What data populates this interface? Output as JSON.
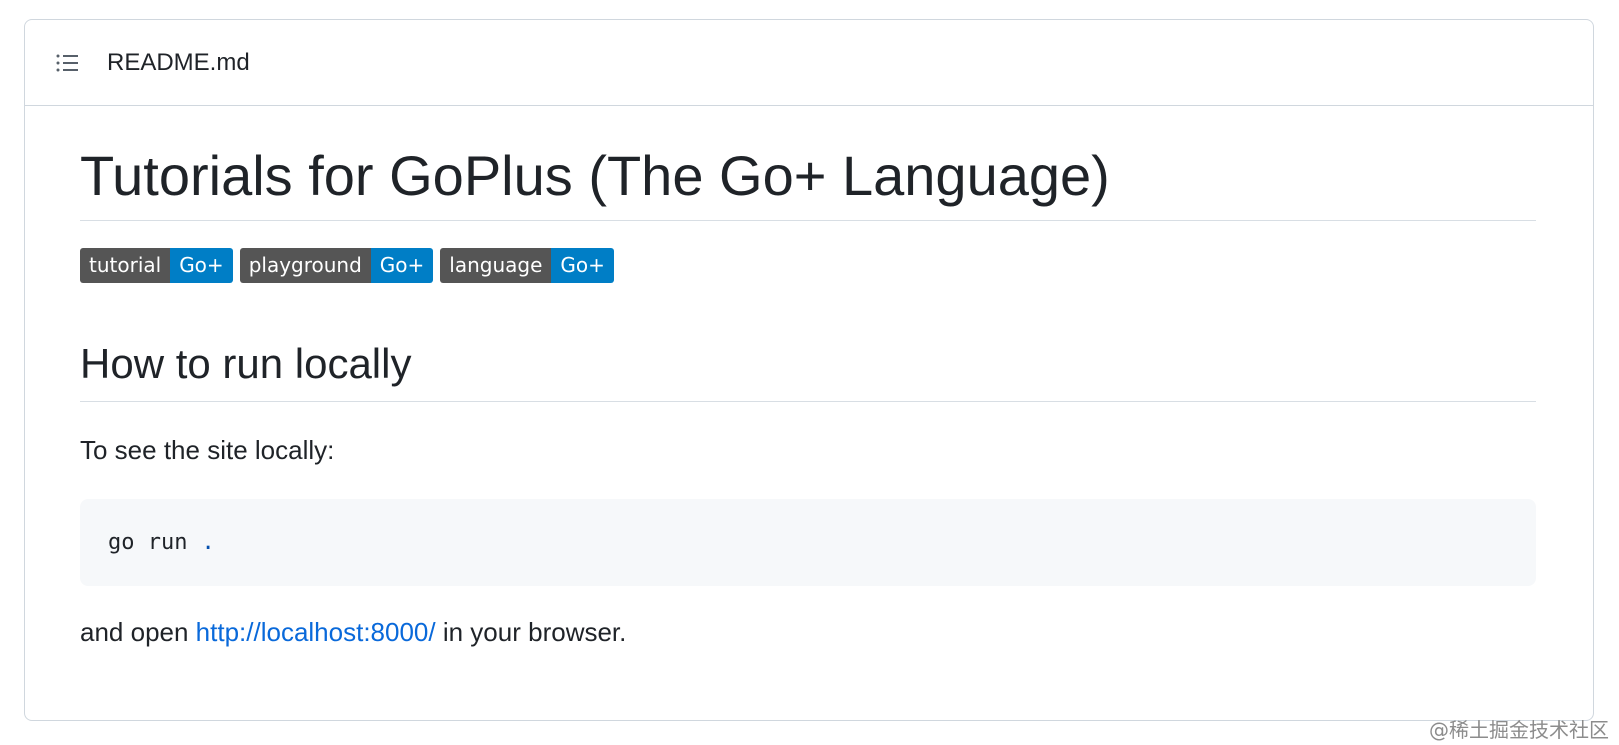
{
  "header": {
    "icon": "list-icon",
    "title": "README.md"
  },
  "readme": {
    "title": "Tutorials for GoPlus (The Go+ Language)",
    "badges": [
      {
        "left": "tutorial",
        "right": "Go+"
      },
      {
        "left": "playground",
        "right": "Go+"
      },
      {
        "left": "language",
        "right": "Go+"
      }
    ],
    "section_heading": "How to run locally",
    "intro_text": "To see the site locally:",
    "code": {
      "command": "go run",
      "arg": "."
    },
    "outro": {
      "before": "and open ",
      "link": "http://localhost:8000/",
      "after": " in your browser."
    }
  },
  "watermark": "@稀土掘金技术社区",
  "colors": {
    "badge_left": "#555555",
    "badge_right": "#007ec6",
    "link": "#0969da",
    "code_bg": "#f6f8fa",
    "border": "#d0d7de"
  }
}
